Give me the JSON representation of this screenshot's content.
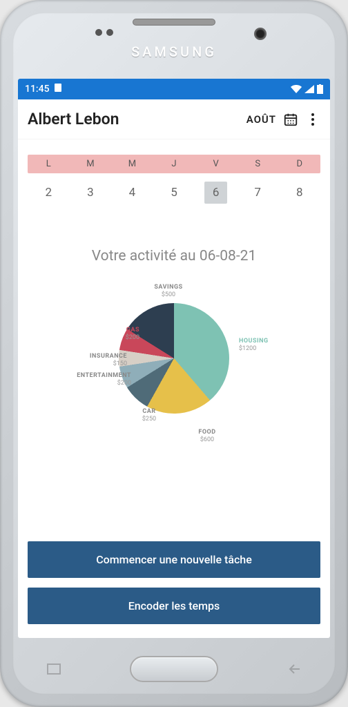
{
  "status": {
    "time": "11:45"
  },
  "header": {
    "title": "Albert Lebon",
    "month": "AOÛT"
  },
  "week": {
    "labels": [
      "L",
      "M",
      "M",
      "J",
      "V",
      "S",
      "D"
    ],
    "days": [
      "2",
      "3",
      "4",
      "5",
      "6",
      "7",
      "8"
    ],
    "selected": "6"
  },
  "activity": {
    "title": "Votre activité au 06-08-21"
  },
  "buttons": {
    "start": "Commencer une nouvelle tâche",
    "encode": "Encoder les temps"
  },
  "chart_data": {
    "type": "pie",
    "title": "",
    "series": [
      {
        "name": "HOUSING",
        "value": 1200,
        "label": "$1200",
        "color": "#7ec2b3"
      },
      {
        "name": "FOOD",
        "value": 600,
        "label": "$600",
        "color": "#e6c04a"
      },
      {
        "name": "CAR",
        "value": 250,
        "label": "$250",
        "color": "#4f6b78"
      },
      {
        "name": "ENTERTAINMENT",
        "value": 200,
        "label": "$200",
        "color": "#8faeb9"
      },
      {
        "name": "INSURANCE",
        "value": 150,
        "label": "$150",
        "color": "#d7cfc6"
      },
      {
        "name": "GAS",
        "value": 200,
        "label": "$200",
        "color": "#c9475a"
      },
      {
        "name": "SAVINGS",
        "value": 500,
        "label": "$500",
        "color": "#2d3e50"
      }
    ]
  }
}
